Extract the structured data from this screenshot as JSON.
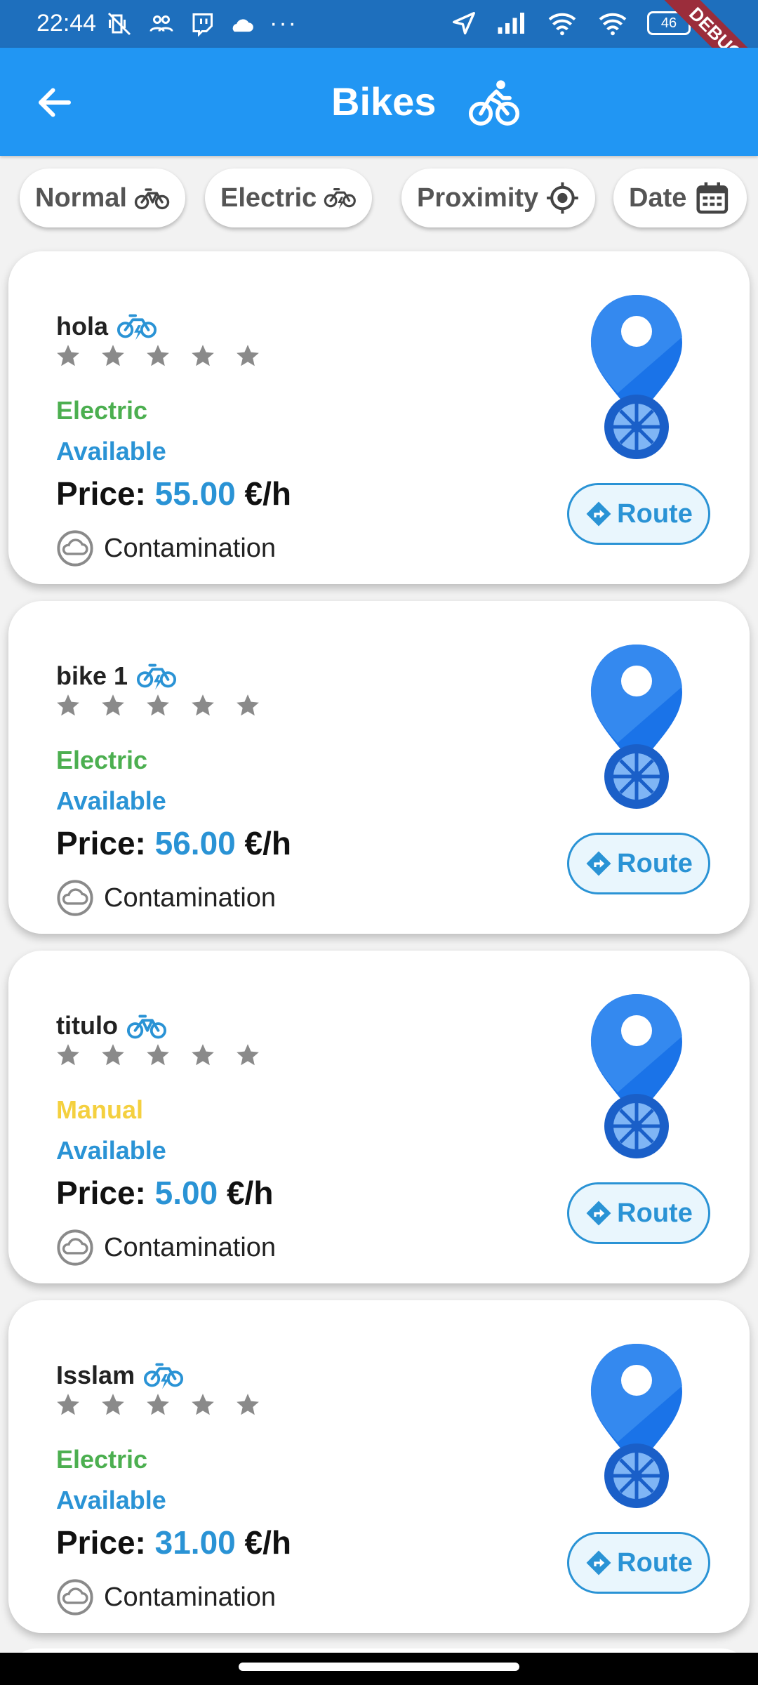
{
  "status_bar": {
    "time": "22:44",
    "battery": "46",
    "icons_left": [
      "mute-vibrate-icon",
      "group-icon",
      "twitch-icon",
      "cloud-icon",
      "more-dots-icon"
    ],
    "icons_right": [
      "location-arrow-icon",
      "signal-icon",
      "wifi-icon",
      "wifi-icon",
      "battery-icon"
    ],
    "debug_banner": "DEBUG"
  },
  "app_bar": {
    "title": "Bikes",
    "back_icon": "back-arrow-icon",
    "title_icon": "bike-rider-icon",
    "color": "#2196f3"
  },
  "filters": [
    {
      "label": "Normal",
      "icon": "bike-icon"
    },
    {
      "label": "Electric",
      "icon": "electric-bike-icon"
    },
    {
      "label": "Proximity",
      "icon": "gps-target-icon"
    },
    {
      "label": "Date",
      "icon": "calendar-icon"
    }
  ],
  "bikes": [
    {
      "name": "hola",
      "bike_icon": "electric-bike-icon",
      "rating": 0,
      "max_rating": 5,
      "type": "Electric",
      "type_color": "#4caf50",
      "status": "Available",
      "price_label": "Price:",
      "price": "55.00",
      "unit": "€/h",
      "contamination": "Contamination",
      "route_label": "Route"
    },
    {
      "name": "bike 1",
      "bike_icon": "electric-bike-icon",
      "rating": 0,
      "max_rating": 5,
      "type": "Electric",
      "type_color": "#4caf50",
      "status": "Available",
      "price_label": "Price:",
      "price": "56.00",
      "unit": "€/h",
      "contamination": "Contamination",
      "route_label": "Route"
    },
    {
      "name": "titulo",
      "bike_icon": "bike-icon",
      "rating": 0,
      "max_rating": 5,
      "type": "Manual",
      "type_color": "#f4d03f",
      "status": "Available",
      "price_label": "Price:",
      "price": "5.00",
      "unit": "€/h",
      "contamination": "Contamination",
      "route_label": "Route"
    },
    {
      "name": "Isslam",
      "bike_icon": "electric-bike-icon",
      "rating": 0,
      "max_rating": 5,
      "type": "Electric",
      "type_color": "#4caf50",
      "status": "Available",
      "price_label": "Price:",
      "price": "31.00",
      "unit": "€/h",
      "contamination": "Contamination",
      "route_label": "Route"
    }
  ],
  "colors": {
    "accent": "#2a93d5",
    "electric": "#4caf50",
    "manual": "#f4d03f",
    "star": "#8a8a8a"
  }
}
